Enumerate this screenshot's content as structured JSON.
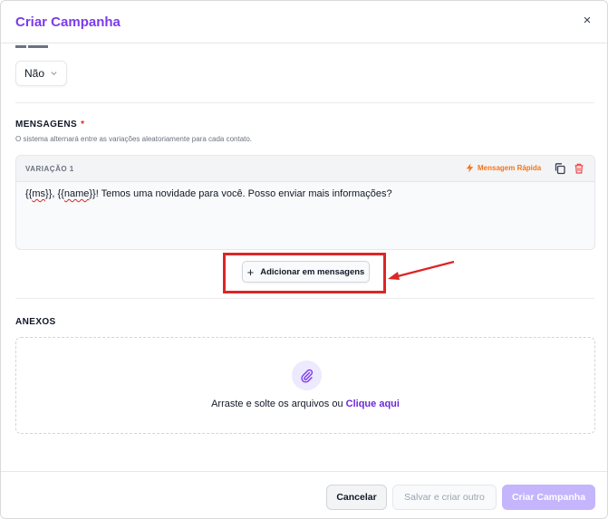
{
  "dialog": {
    "title": "Criar Campanha",
    "close_glyph": "×"
  },
  "top_field": {
    "value": "Não"
  },
  "messages": {
    "label": "MENSAGENS",
    "required_mark": "*",
    "hint": "O sistema alternará entre as variações aleatoriamente para cada contato.",
    "variation": {
      "title": "VARIAÇÃO 1",
      "quick_label": "Mensagem Rápida",
      "text_prefix": "{{",
      "text_ms": "ms",
      "text_mid": "}}, {{",
      "text_name": "name",
      "text_rest": "}}! Temos uma novidade para você. Posso enviar mais informações?"
    },
    "add_button_label": "Adicionar em mensagens"
  },
  "attachments": {
    "label": "ANEXOS",
    "drop_text": "Arraste e solte os arquivos ou",
    "drop_link": "Clique aqui"
  },
  "footer": {
    "cancel_label": "Cancelar",
    "save_other_label": "Salvar e criar outro",
    "create_label": "Criar Campanha"
  },
  "colors": {
    "accent": "#7c3aed",
    "quick_action": "#f97316",
    "annotation": "#dc2626"
  },
  "icons": {
    "close": "close-icon",
    "chevron": "chevron-down-icon",
    "quick": "lightning-icon",
    "copy": "copy-icon",
    "delete": "trash-icon",
    "add": "plus-icon",
    "attach": "paperclip-icon",
    "annotation": "arrow-icon"
  }
}
